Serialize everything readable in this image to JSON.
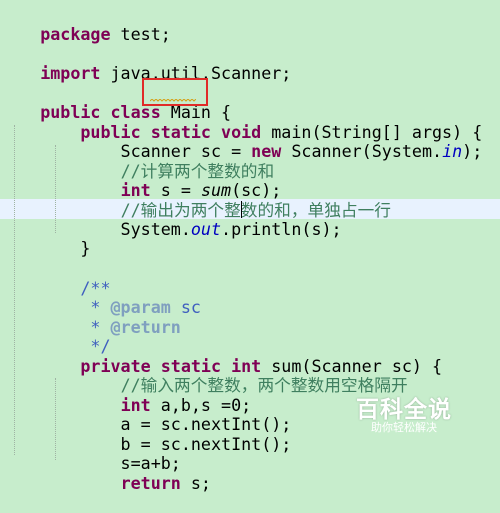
{
  "editor": {
    "background": "#c7edcc",
    "current_line_color": "#e8f2fe",
    "lines": {
      "l1": {
        "kw1": "package",
        "rest": " test;"
      },
      "l3": {
        "kw1": "import",
        "rest": " java.util.Scanner;"
      },
      "l5": {
        "kw1": "public",
        "sp1": " ",
        "kw2": "class",
        "sp2": " ",
        "classname": "Main",
        "rest": " {"
      },
      "l6": {
        "indent": "    ",
        "kw1": "public",
        "sp1": " ",
        "kw2": "static",
        "sp2": " ",
        "kw3": "void",
        "rest": " main(String[] args) {"
      },
      "l7": {
        "a": "        Scanner sc = ",
        "kw1": "new",
        "b": " Scanner(System.",
        "field": "in",
        "c": ");"
      },
      "l8": {
        "indent": "        ",
        "comment": "//计算两个整数的和"
      },
      "l9": {
        "indent": "        ",
        "kw1": "int",
        "a": " s = ",
        "method": "sum",
        "b": "(sc);"
      },
      "l10": {
        "indent": "        ",
        "comment": "//输出为两个整数的和，单独占一行"
      },
      "l11": {
        "a": "        System.",
        "field": "out",
        "b": ".println(s);"
      },
      "l12": {
        "text": "    }"
      },
      "l14": {
        "indent": "    ",
        "jd": "/**"
      },
      "l15": {
        "indent": "     ",
        "star": "* ",
        "tag": "@param",
        "rest": " sc"
      },
      "l16": {
        "indent": "     ",
        "star": "* ",
        "tag": "@return"
      },
      "l17": {
        "indent": "     ",
        "jd": "*/"
      },
      "l18": {
        "indent": "    ",
        "kw1": "private",
        "sp1": " ",
        "kw2": "static",
        "sp2": " ",
        "kw3": "int",
        "rest": " sum(Scanner sc) {"
      },
      "l19": {
        "indent": "        ",
        "comment": "//输入两个整数，两个整数用空格隔开"
      },
      "l20": {
        "indent": "        ",
        "kw1": "int",
        "rest": " a,b,s =0;"
      },
      "l21": {
        "text": "        a = sc.nextInt();"
      },
      "l22": {
        "text": "        b = sc.nextInt();"
      },
      "l23": {
        "text": "        s=a+b;"
      },
      "l24": {
        "indent": "        ",
        "kw1": "return",
        "rest": " s;"
      }
    }
  },
  "watermark": {
    "title": "百科全说",
    "subtitle": "助你轻松解决",
    "color": "#e03a3a"
  }
}
